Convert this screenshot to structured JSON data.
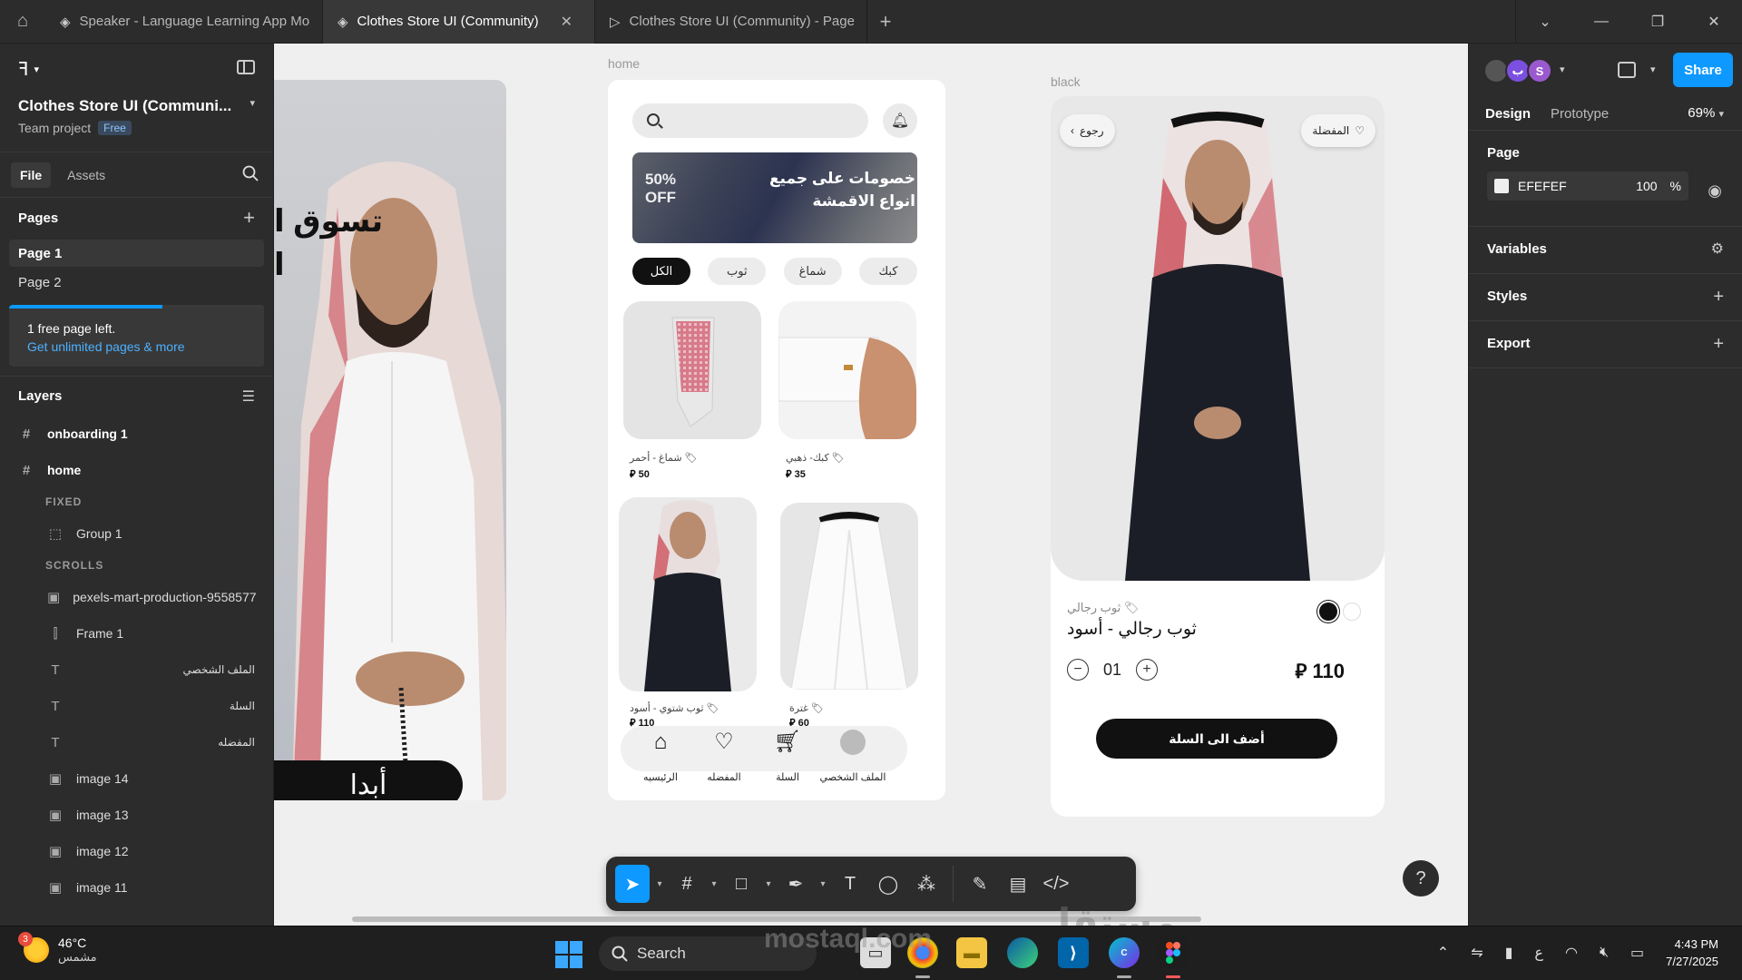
{
  "titlebar": {
    "tabs": [
      {
        "label": "Speaker - Language Learning App Mo",
        "active": false
      },
      {
        "label": "Clothes Store UI (Community)",
        "active": true
      },
      {
        "label": "Clothes Store UI (Community) - Page",
        "active": false
      }
    ]
  },
  "left_panel": {
    "project_title": "Clothes Store UI (Communi...",
    "team": "Team project",
    "plan_badge": "Free",
    "tabs": {
      "file": "File",
      "assets": "Assets"
    },
    "pages_title": "Pages",
    "pages": [
      "Page 1",
      "Page 2"
    ],
    "upsell": {
      "text": "1 free page left.",
      "link": "Get unlimited pages & more",
      "progress": 0.6
    },
    "layers_title": "Layers",
    "layers": [
      {
        "label": "onboarding 1",
        "type": "frame"
      },
      {
        "label": "home",
        "type": "frame"
      },
      {
        "label": "FIXED",
        "type": "group-label"
      },
      {
        "label": "Group 1",
        "type": "group"
      },
      {
        "label": "SCROLLS",
        "type": "group-label"
      },
      {
        "label": "pexels-mart-production-9558577",
        "type": "image"
      },
      {
        "label": "Frame 1",
        "type": "autolayout"
      },
      {
        "label": "الملف الشخصي",
        "type": "text"
      },
      {
        "label": "السلة",
        "type": "text"
      },
      {
        "label": "المفضله",
        "type": "text"
      },
      {
        "label": "image 14",
        "type": "image"
      },
      {
        "label": "image 13",
        "type": "image"
      },
      {
        "label": "image 12",
        "type": "image"
      },
      {
        "label": "image 11",
        "type": "image"
      }
    ]
  },
  "canvas": {
    "labels": {
      "home": "home",
      "black": "black"
    },
    "onboarding": {
      "title_line1": "تسوق ا",
      "title_line2": "ا",
      "cta": "أبدا"
    },
    "home": {
      "banner": {
        "off_pct": "50%",
        "off_word": "OFF",
        "line1": "خصومات على جميع",
        "line2": "انواع الاقمشة"
      },
      "chips": [
        "الكل",
        "ثوب",
        "شماغ",
        "كبك"
      ],
      "products": [
        {
          "name": "شماغ - أحمر",
          "price": "50"
        },
        {
          "name": "كبك- ذهبي",
          "price": "35"
        },
        {
          "name": "ثوب شتوي - أسود",
          "price": "110"
        },
        {
          "name": "غترة",
          "price": "60"
        }
      ],
      "nav": [
        "الرئيسيه",
        "المفضله",
        "السلة",
        "الملف الشخصي"
      ]
    },
    "black": {
      "back": "رجوع",
      "favorite": "المفضلة",
      "category": "ثوب رجالي",
      "name": "ثوب رجالي - أسود",
      "qty": "01",
      "price": "110",
      "add_to_cart": "أضف الى السلة"
    },
    "watermark": "mostaql.com"
  },
  "right_panel": {
    "avatars": [
      "ب",
      "S"
    ],
    "share": "Share",
    "tabs": {
      "design": "Design",
      "prototype": "Prototype"
    },
    "zoom": "69%",
    "page_title": "Page",
    "page_fill": {
      "hex": "EFEFEF",
      "opacity": "100",
      "unit": "%"
    },
    "sections": [
      "Variables",
      "Styles",
      "Export"
    ]
  },
  "taskbar": {
    "weather_temp": "46°C",
    "weather_desc": "مشمس",
    "weather_badge": "3",
    "search": "Search",
    "lang": "ع",
    "time": "4:43 PM",
    "date": "7/27/2025"
  },
  "colors": {
    "accent": "#0d99ff",
    "canvas": "#efefef",
    "panel": "#2c2c2c"
  }
}
